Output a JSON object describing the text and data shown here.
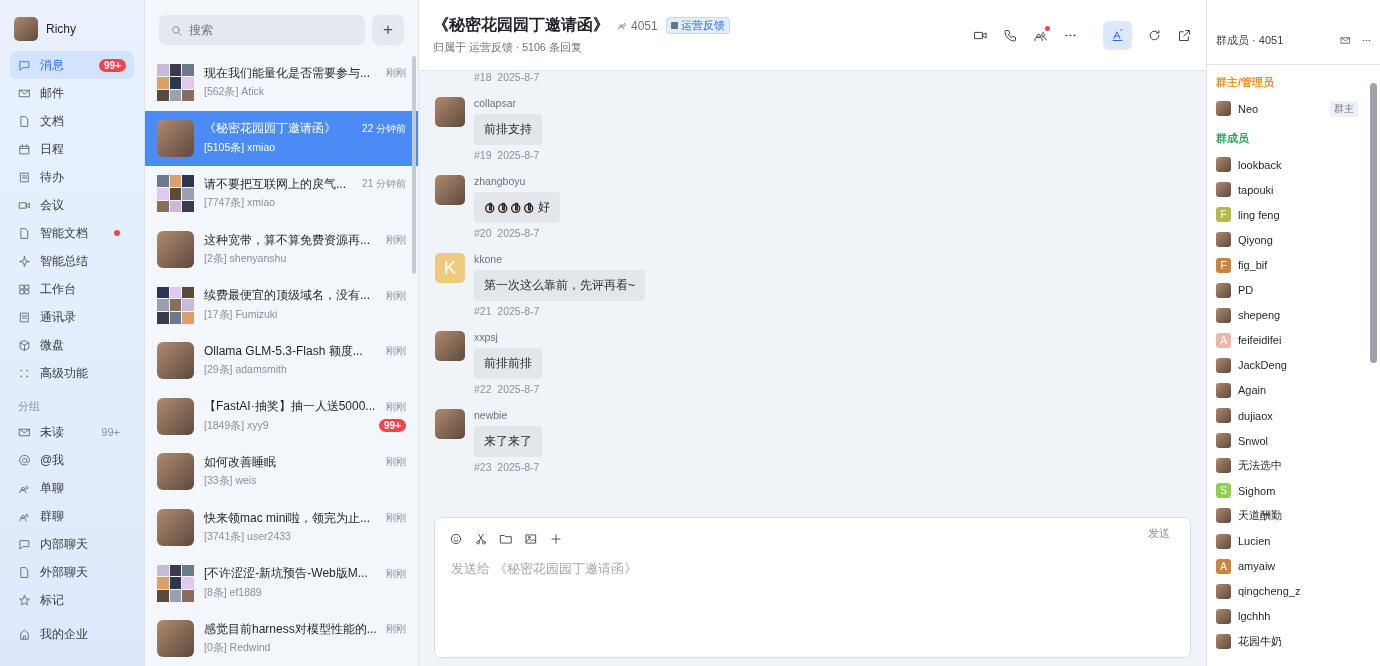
{
  "user": {
    "name": "Richy"
  },
  "nav": [
    {
      "label": "消息",
      "selected": true,
      "badge": "99+",
      "dot": false
    },
    {
      "label": "邮件",
      "selected": false,
      "dot": false
    },
    {
      "label": "文档",
      "selected": false,
      "dot": false
    },
    {
      "label": "日程",
      "selected": false,
      "dot": false
    },
    {
      "label": "待办",
      "selected": false,
      "dot": false
    },
    {
      "label": "会议",
      "selected": false,
      "dot": false
    },
    {
      "label": "智能文档",
      "selected": false,
      "dot": true
    },
    {
      "label": "智能总结",
      "selected": false,
      "dot": false
    },
    {
      "label": "工作台",
      "selected": false,
      "dot": false
    },
    {
      "label": "通讯录",
      "selected": false,
      "dot": false
    },
    {
      "label": "微盘",
      "selected": false,
      "dot": false
    },
    {
      "label": "高级功能",
      "selected": false,
      "dot": false
    }
  ],
  "groups": {
    "title": "分组",
    "items": [
      {
        "label": "未读",
        "count": "99+"
      },
      {
        "label": "@我"
      },
      {
        "label": "单聊"
      },
      {
        "label": "群聊"
      },
      {
        "label": "内部聊天"
      },
      {
        "label": "外部聊天"
      },
      {
        "label": "标记"
      }
    ]
  },
  "enterprise": {
    "label": "我的企业"
  },
  "search": {
    "placeholder": "搜索",
    "add": "+"
  },
  "chats": [
    {
      "title": "现在我们能量化是否需要参与...",
      "sub": "[562条] Atick",
      "time": "刚刚",
      "kind": "group",
      "selected": false
    },
    {
      "title": "《秘密花园园丁邀请函》",
      "sub": "[5105条] xmiao",
      "time": "22 分钟前",
      "kind": "single",
      "selected": true
    },
    {
      "title": "请不要把互联网上的戾气...",
      "sub": "[7747条] xmiao",
      "time": "21 分钟前",
      "kind": "group",
      "selected": false
    },
    {
      "title": "这种宽带，算不算免费资源再...",
      "sub": "[2条] shenyanshu",
      "time": "刚刚",
      "kind": "single",
      "selected": false
    },
    {
      "title": "续费最便宜的顶级域名，没有...",
      "sub": "[17条] Fumizuki",
      "time": "刚刚",
      "kind": "group",
      "selected": false
    },
    {
      "title": "Ollama GLM-5.3-Flash 额度...",
      "sub": "[29条] adamsmith",
      "time": "刚刚",
      "kind": "single",
      "selected": false
    },
    {
      "title": "【FastAI·抽奖】抽一人送5000...",
      "sub": "[1849条] xyy9",
      "time": "刚刚",
      "kind": "single",
      "selected": false,
      "badge": "99+"
    },
    {
      "title": "如何改善睡眠",
      "sub": "[33条] weis",
      "time": "刚刚",
      "kind": "single",
      "selected": false
    },
    {
      "title": "快来领mac mini啦，领完为止...",
      "sub": "[3741条] user2433",
      "time": "刚刚",
      "kind": "single",
      "selected": false
    },
    {
      "title": "[不许涩涩-新坑预告-Web版M...",
      "sub": "[8条] ef1889",
      "time": "刚刚",
      "kind": "group",
      "selected": false
    },
    {
      "title": "感觉目前harness对模型性能的...",
      "sub": "[0条] Redwind",
      "time": "刚刚",
      "kind": "single",
      "selected": false
    }
  ],
  "header": {
    "title": "《秘密花园园丁邀请函》",
    "members": "4051",
    "tag": "运营反馈",
    "subtitle": "归属于 运营反馈 · 5106 条回复",
    "translate_on": true,
    "people_dot": true
  },
  "messages": [
    {
      "kind": "meta-only",
      "number": "#18",
      "date": "2025-8-7"
    },
    {
      "kind": "text",
      "user": "collapsar",
      "text": "前排支持",
      "number": "#19",
      "date": "2025-8-7"
    },
    {
      "kind": "emoji",
      "user": "zhangboyu",
      "text": "好",
      "number": "#20",
      "date": "2025-8-7"
    },
    {
      "kind": "text",
      "user": "kkone",
      "text": "第一次这么靠前，先评再看~",
      "number": "#21",
      "date": "2025-8-7",
      "letter": "K",
      "color": "#eecb7c"
    },
    {
      "kind": "text",
      "user": "xxpsj",
      "text": "前排前排",
      "number": "#22",
      "date": "2025-8-7"
    },
    {
      "kind": "text",
      "user": "newbie",
      "text": "来了来了",
      "number": "#23",
      "date": "2025-8-7"
    }
  ],
  "composer": {
    "placeholder": "发送给 《秘密花园园丁邀请函》",
    "send": "发送"
  },
  "members_panel": {
    "title": "群成员 · 4051",
    "sections": [
      {
        "title": "群主/管理员",
        "color": "#e6951e",
        "members": [
          {
            "name": "Neo",
            "role": "群主"
          }
        ]
      },
      {
        "title": "群成员",
        "color": "#2ea55a",
        "members": [
          {
            "name": "lookback"
          },
          {
            "name": "tapouki"
          },
          {
            "name": "ling feng",
            "letter": "F",
            "color": "#b5b84a"
          },
          {
            "name": "Qiyong"
          },
          {
            "name": "fig_bif",
            "letter": "F",
            "color": "#c8853f"
          },
          {
            "name": "PD"
          },
          {
            "name": "shepeng"
          },
          {
            "name": "feifeidifei",
            "letter": "A",
            "color": "#eab8aa"
          },
          {
            "name": "JackDeng"
          },
          {
            "name": "Again"
          },
          {
            "name": "dujiaox"
          },
          {
            "name": "Snwol"
          },
          {
            "name": "无法选中"
          },
          {
            "name": "Sighom",
            "letter": "S",
            "color": "#8fd14f"
          },
          {
            "name": "天道酬勤"
          },
          {
            "name": "Lucien"
          },
          {
            "name": "amyaiw",
            "letter": "A",
            "color": "#c8853f"
          },
          {
            "name": "qingcheng_z"
          },
          {
            "name": "lgchhh"
          },
          {
            "name": "花园牛奶"
          }
        ]
      }
    ]
  }
}
